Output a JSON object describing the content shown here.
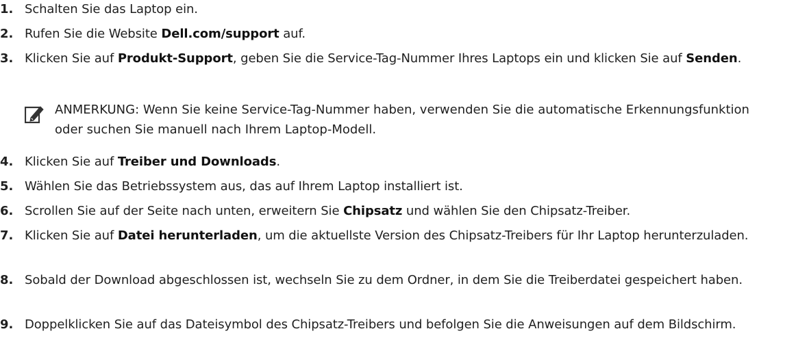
{
  "steps": [
    {
      "num": "1.",
      "parts": [
        {
          "t": "Schalten Sie das Laptop ein."
        }
      ]
    },
    {
      "num": "2.",
      "parts": [
        {
          "t": "Rufen Sie die Website "
        },
        {
          "t": "Dell.com/support",
          "b": true
        },
        {
          "t": " auf."
        }
      ]
    },
    {
      "num": "3.",
      "parts": [
        {
          "t": "Klicken Sie auf "
        },
        {
          "t": "Produkt-Support",
          "b": true
        },
        {
          "t": ", geben Sie die Service-Tag-Nummer Ihres Laptops ein und klicken Sie auf "
        },
        {
          "t": "Senden",
          "b": true
        },
        {
          "t": "."
        }
      ]
    },
    {
      "num": "4.",
      "parts": [
        {
          "t": "Klicken Sie auf "
        },
        {
          "t": "Treiber und Downloads",
          "b": true
        },
        {
          "t": "."
        }
      ]
    },
    {
      "num": "5.",
      "parts": [
        {
          "t": "Wählen Sie das Betriebssystem aus, das auf Ihrem Laptop installiert ist."
        }
      ]
    },
    {
      "num": "6.",
      "parts": [
        {
          "t": "Scrollen Sie auf der Seite nach unten, erweitern Sie "
        },
        {
          "t": "Chipsatz",
          "b": true
        },
        {
          "t": " und wählen Sie den Chipsatz-Treiber."
        }
      ]
    },
    {
      "num": "7.",
      "parts": [
        {
          "t": "Klicken Sie auf "
        },
        {
          "t": "Datei herunterladen",
          "b": true
        },
        {
          "t": ", um die aktuellste Version des Chipsatz-Treibers für Ihr Laptop herunterzuladen."
        }
      ]
    },
    {
      "num": "8.",
      "parts": [
        {
          "t": "Sobald der Download abgeschlossen ist, wechseln Sie zu dem Ordner, in dem Sie die Treiberdatei gespeichert haben."
        }
      ]
    },
    {
      "num": "9.",
      "parts": [
        {
          "t": "Doppelklicken Sie auf das Dateisymbol des Chipsatz-Treibers und befolgen Sie die Anweisungen auf dem Bildschirm."
        }
      ]
    }
  ],
  "note": {
    "label": "ANMERKUNG:",
    "text": " Wenn Sie keine Service-Tag-Nummer haben, verwenden Sie die automatische Erkennungsfunktion oder suchen Sie manuell nach Ihrem Laptop-Modell.",
    "icon": "pencil-note-icon"
  }
}
